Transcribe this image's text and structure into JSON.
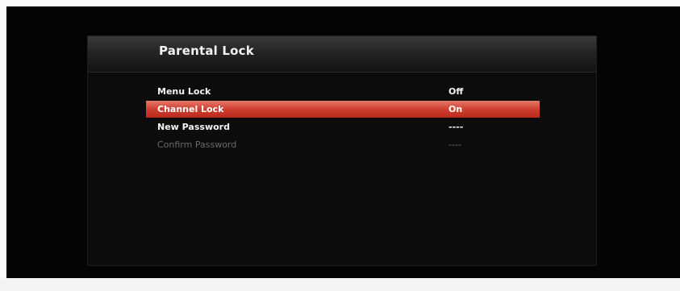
{
  "panel": {
    "title": "Parental Lock"
  },
  "menu": {
    "items": [
      {
        "label": "Menu Lock",
        "value": "Off",
        "state": "normal"
      },
      {
        "label": "Channel Lock",
        "value": "On",
        "state": "selected"
      },
      {
        "label": "New Password",
        "value": "----",
        "state": "normal"
      },
      {
        "label": "Confirm Password",
        "value": "----",
        "state": "disabled"
      }
    ]
  },
  "colors": {
    "highlight": "#cf3f30",
    "background": "#040404",
    "text": "#f4f4f4",
    "disabled_text": "#6a6a6a"
  }
}
